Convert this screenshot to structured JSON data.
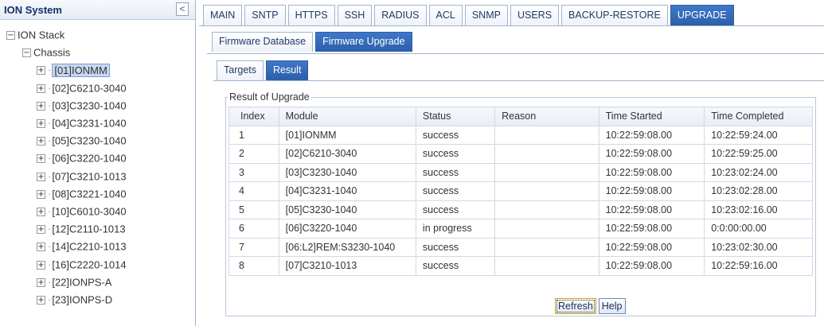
{
  "left_panel": {
    "title": "ION System",
    "collapse_label": "<",
    "tree": [
      {
        "label": "ION Stack",
        "toggle": "−",
        "level": 0
      },
      {
        "label": "Chassis",
        "toggle": "−",
        "level": 1
      },
      {
        "label": "[01]IONMM",
        "toggle": "+",
        "level": 2,
        "selected": true
      },
      {
        "label": "[02]C6210-3040",
        "toggle": "+",
        "level": 2
      },
      {
        "label": "[03]C3230-1040",
        "toggle": "+",
        "level": 2
      },
      {
        "label": "[04]C3231-1040",
        "toggle": "+",
        "level": 2
      },
      {
        "label": "[05]C3230-1040",
        "toggle": "+",
        "level": 2
      },
      {
        "label": "[06]C3220-1040",
        "toggle": "+",
        "level": 2
      },
      {
        "label": "[07]C3210-1013",
        "toggle": "+",
        "level": 2
      },
      {
        "label": "[08]C3221-1040",
        "toggle": "+",
        "level": 2
      },
      {
        "label": "[10]C6010-3040",
        "toggle": "+",
        "level": 2
      },
      {
        "label": "[12]C2110-1013",
        "toggle": "+",
        "level": 2
      },
      {
        "label": "[14]C2210-1013",
        "toggle": "+",
        "level": 2
      },
      {
        "label": "[16]C2220-1014",
        "toggle": "+",
        "level": 2
      },
      {
        "label": "[22]IONPS-A",
        "toggle": "+",
        "level": 2
      },
      {
        "label": "[23]IONPS-D",
        "toggle": "+",
        "level": 2
      }
    ]
  },
  "top_tabs": [
    {
      "label": "MAIN"
    },
    {
      "label": "SNTP"
    },
    {
      "label": "HTTPS"
    },
    {
      "label": "SSH"
    },
    {
      "label": "RADIUS"
    },
    {
      "label": "ACL"
    },
    {
      "label": "SNMP"
    },
    {
      "label": "USERS"
    },
    {
      "label": "BACKUP-RESTORE"
    },
    {
      "label": "UPGRADE",
      "active": true
    }
  ],
  "sub_tabs": [
    {
      "label": "Firmware Database"
    },
    {
      "label": "Firmware Upgrade",
      "active": true
    }
  ],
  "inner_tabs": [
    {
      "label": "Targets"
    },
    {
      "label": "Result",
      "active": true
    }
  ],
  "result": {
    "legend": "Result of Upgrade",
    "columns": [
      "Index",
      "Module",
      "Status",
      "Reason",
      "Time Started",
      "Time Completed"
    ],
    "rows": [
      [
        "1",
        "[01]IONMM",
        "success",
        "",
        "10:22:59:08.00",
        "10:22:59:24.00"
      ],
      [
        "2",
        "[02]C6210-3040",
        "success",
        "",
        "10:22:59:08.00",
        "10:22:59:25.00"
      ],
      [
        "3",
        "[03]C3230-1040",
        "success",
        "",
        "10:22:59:08.00",
        "10:23:02:24.00"
      ],
      [
        "4",
        "[04]C3231-1040",
        "success",
        "",
        "10:22:59:08.00",
        "10:23:02:28.00"
      ],
      [
        "5",
        "[05]C3230-1040",
        "success",
        "",
        "10:22:59:08.00",
        "10:23:02:16.00"
      ],
      [
        "6",
        "[06]C3220-1040",
        "in progress",
        "",
        "10:22:59:08.00",
        "0:0:00:00.00"
      ],
      [
        "7",
        "[06:L2]REM:S3230-1040",
        "success",
        "",
        "10:22:59:08.00",
        "10:23:02:30.00"
      ],
      [
        "8",
        "[07]C3210-1013",
        "success",
        "",
        "10:22:59:08.00",
        "10:22:59:16.00"
      ]
    ]
  },
  "buttons": {
    "refresh_label": "Refresh",
    "help_label": "Help"
  },
  "colors": {
    "active_tab": "#2c5ea8",
    "border": "#9fb4cf",
    "selected_node": "#c8d7f0"
  }
}
